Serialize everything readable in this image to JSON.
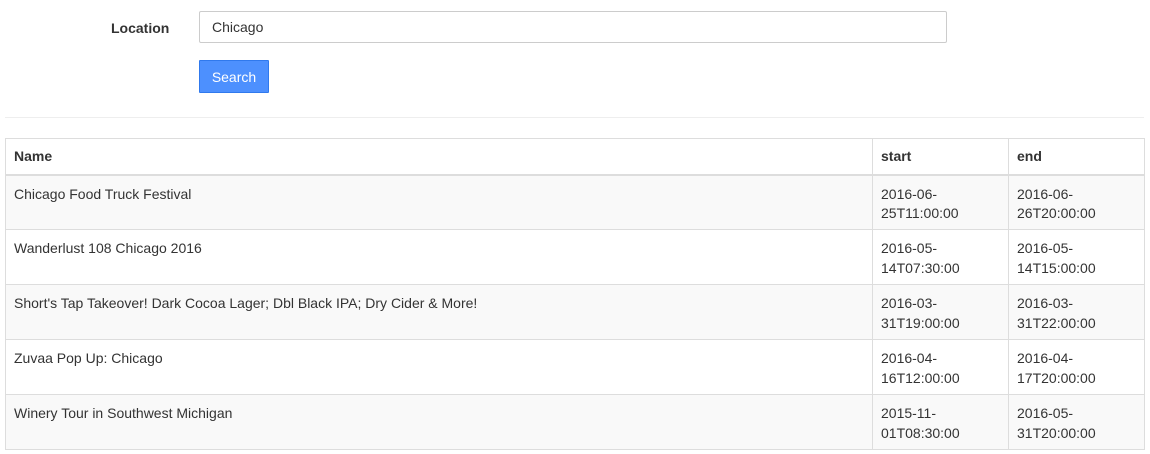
{
  "form": {
    "location_label": "Location",
    "location_value": "Chicago",
    "search_label": "Search"
  },
  "table": {
    "headers": [
      "Name",
      "start",
      "end"
    ],
    "rows": [
      {
        "name": "Chicago Food Truck Festival",
        "start": "2016-06-25T11:00:00",
        "end": "2016-06-26T20:00:00"
      },
      {
        "name": "Wanderlust 108 Chicago 2016",
        "start": "2016-05-14T07:30:00",
        "end": "2016-05-14T15:00:00"
      },
      {
        "name": "Short's Tap Takeover! Dark Cocoa Lager; Dbl Black IPA; Dry Cider & More!",
        "start": "2016-03-31T19:00:00",
        "end": "2016-03-31T22:00:00"
      },
      {
        "name": "Zuvaa Pop Up: Chicago",
        "start": "2016-04-16T12:00:00",
        "end": "2016-04-17T20:00:00"
      },
      {
        "name": "Winery Tour in Southwest Michigan",
        "start": "2015-11-01T08:30:00",
        "end": "2016-05-31T20:00:00"
      }
    ]
  },
  "colors": {
    "button_bg": "#4d90fe",
    "button_border": "#3079ed",
    "stripe": "#f9f9f9",
    "border": "#dddddd"
  }
}
